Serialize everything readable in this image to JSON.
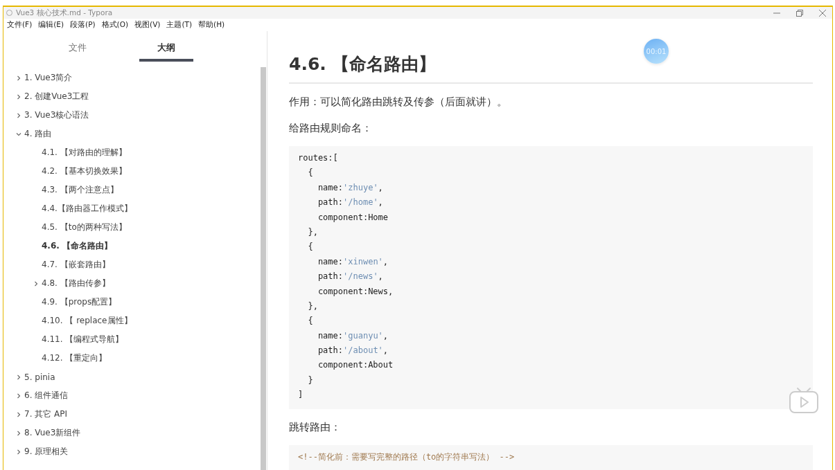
{
  "window": {
    "title": "Vue3 核心技术.md - Typora"
  },
  "menu": [
    "文件(F)",
    "编辑(E)",
    "段落(P)",
    "格式(O)",
    "视图(V)",
    "主题(T)",
    "帮助(H)"
  ],
  "sidebar": {
    "tabs": [
      {
        "label": "文件",
        "selected": false
      },
      {
        "label": "大纲",
        "selected": true
      }
    ],
    "outline": [
      {
        "label": "1. Vue3简介",
        "expandable": true,
        "expanded": false,
        "selected": false
      },
      {
        "label": "2. 创建Vue3工程",
        "expandable": true,
        "expanded": false,
        "selected": false
      },
      {
        "label": "3. Vue3核心语法",
        "expandable": true,
        "expanded": false,
        "selected": false
      },
      {
        "label": "4. 路由",
        "expandable": true,
        "expanded": true,
        "selected": false,
        "children": [
          {
            "label": "4.1. 【对路由的理解】",
            "expandable": false,
            "selected": false
          },
          {
            "label": "4.2. 【基本切换效果】",
            "expandable": false,
            "selected": false
          },
          {
            "label": "4.3. 【两个注意点】",
            "expandable": false,
            "selected": false
          },
          {
            "label": "4.4.【路由器工作模式】",
            "expandable": false,
            "selected": false
          },
          {
            "label": "4.5. 【to的两种写法】",
            "expandable": false,
            "selected": false
          },
          {
            "label": "4.6. 【命名路由】",
            "expandable": false,
            "selected": true
          },
          {
            "label": "4.7. 【嵌套路由】",
            "expandable": false,
            "selected": false
          },
          {
            "label": "4.8. 【路由传参】",
            "expandable": true,
            "expanded": false,
            "selected": false
          },
          {
            "label": "4.9. 【props配置】",
            "expandable": false,
            "selected": false
          },
          {
            "label": "4.10. 【 replace属性】",
            "expandable": false,
            "selected": false
          },
          {
            "label": "4.11. 【编程式导航】",
            "expandable": false,
            "selected": false
          },
          {
            "label": "4.12. 【重定向】",
            "expandable": false,
            "selected": false
          }
        ]
      },
      {
        "label": "5. pinia",
        "expandable": true,
        "expanded": false,
        "selected": false
      },
      {
        "label": "6. 组件通信",
        "expandable": true,
        "expanded": false,
        "selected": false
      },
      {
        "label": "7. 其它 API",
        "expandable": true,
        "expanded": false,
        "selected": false
      },
      {
        "label": "8. Vue3新组件",
        "expandable": true,
        "expanded": false,
        "selected": false
      },
      {
        "label": "9. 原理相关",
        "expandable": true,
        "expanded": false,
        "selected": false
      }
    ]
  },
  "document": {
    "heading": "4.6. 【命名路由】",
    "blocks": [
      {
        "kind": "paragraph",
        "text": "作用：可以简化路由跳转及传参（后面就讲）。"
      },
      {
        "kind": "paragraph",
        "text": "给路由规则命名："
      },
      {
        "kind": "code",
        "lines": [
          [
            {
              "text": "routes:[",
              "kind": "plain"
            }
          ],
          [
            {
              "text": "  {",
              "kind": "plain"
            }
          ],
          [
            {
              "text": "    name:",
              "kind": "plain"
            },
            {
              "text": "'zhuye'",
              "kind": "string"
            },
            {
              "text": ",",
              "kind": "plain"
            }
          ],
          [
            {
              "text": "    path:",
              "kind": "plain"
            },
            {
              "text": "'/home'",
              "kind": "string"
            },
            {
              "text": ",",
              "kind": "plain"
            }
          ],
          [
            {
              "text": "    component:Home",
              "kind": "plain"
            }
          ],
          [
            {
              "text": "  },",
              "kind": "plain"
            }
          ],
          [
            {
              "text": "  {",
              "kind": "plain"
            }
          ],
          [
            {
              "text": "    name:",
              "kind": "plain"
            },
            {
              "text": "'xinwen'",
              "kind": "string"
            },
            {
              "text": ",",
              "kind": "plain"
            }
          ],
          [
            {
              "text": "    path:",
              "kind": "plain"
            },
            {
              "text": "'/news'",
              "kind": "string"
            },
            {
              "text": ",",
              "kind": "plain"
            }
          ],
          [
            {
              "text": "    component:News,",
              "kind": "plain"
            }
          ],
          [
            {
              "text": "  },",
              "kind": "plain"
            }
          ],
          [
            {
              "text": "  {",
              "kind": "plain"
            }
          ],
          [
            {
              "text": "    name:",
              "kind": "plain"
            },
            {
              "text": "'guanyu'",
              "kind": "string"
            },
            {
              "text": ",",
              "kind": "plain"
            }
          ],
          [
            {
              "text": "    path:",
              "kind": "plain"
            },
            {
              "text": "'/about'",
              "kind": "string"
            },
            {
              "text": ",",
              "kind": "plain"
            }
          ],
          [
            {
              "text": "    component:About",
              "kind": "plain"
            }
          ],
          [
            {
              "text": "  }",
              "kind": "plain"
            }
          ],
          [
            {
              "text": "]",
              "kind": "plain"
            }
          ]
        ]
      },
      {
        "kind": "paragraph",
        "text": "跳转路由："
      },
      {
        "kind": "code",
        "lines": [
          [
            {
              "text": "<!--简化前：需要写完整的路径（to的字符串写法） -->",
              "kind": "comment"
            }
          ]
        ]
      }
    ]
  },
  "timer": {
    "text": "00:01"
  }
}
